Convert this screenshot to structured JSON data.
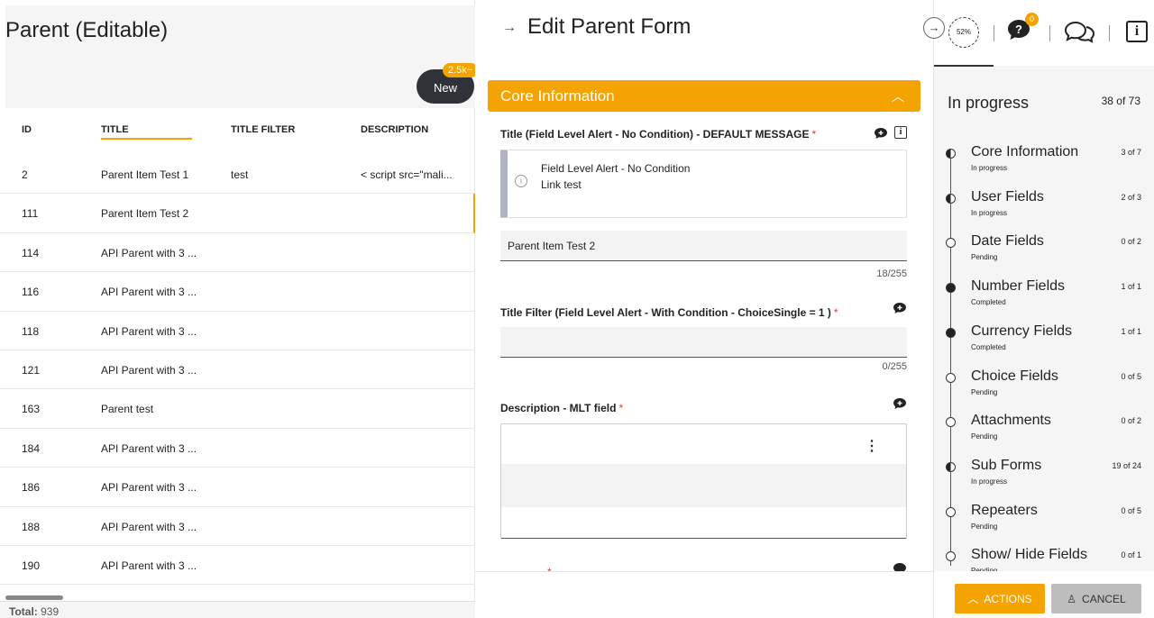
{
  "list": {
    "title": "Parent (Editable)",
    "new_button": "New",
    "new_badge": "2.5k~",
    "columns": [
      "ID",
      "TITLE",
      "TITLE FILTER",
      "DESCRIPTION"
    ],
    "rows": [
      {
        "id": "2",
        "title": "Parent Item Test 1",
        "title_filter": "test",
        "description": "< script  src=\"mali..."
      },
      {
        "id": "111",
        "title": "Parent Item Test 2",
        "title_filter": "",
        "description": ""
      },
      {
        "id": "114",
        "title": "API Parent with 3 ...",
        "title_filter": "",
        "description": ""
      },
      {
        "id": "116",
        "title": "API Parent with 3 ...",
        "title_filter": "",
        "description": ""
      },
      {
        "id": "118",
        "title": "API Parent with 3 ...",
        "title_filter": "",
        "description": ""
      },
      {
        "id": "121",
        "title": "API Parent with 3 ...",
        "title_filter": "",
        "description": ""
      },
      {
        "id": "163",
        "title": "Parent test",
        "title_filter": "",
        "description": ""
      },
      {
        "id": "184",
        "title": "API Parent with 3 ...",
        "title_filter": "",
        "description": ""
      },
      {
        "id": "186",
        "title": "API Parent with 3 ...",
        "title_filter": "",
        "description": ""
      },
      {
        "id": "188",
        "title": "API Parent with 3 ...",
        "title_filter": "",
        "description": ""
      },
      {
        "id": "190",
        "title": "API Parent with 3 ...",
        "title_filter": "",
        "description": ""
      }
    ],
    "total_label": "Total:",
    "total_value": "939"
  },
  "form": {
    "title": "Edit Parent Form",
    "section": "Core Information",
    "field1_label": "Title (Field Level Alert - No Condition) - DEFAULT MESSAGE",
    "alert_line1": "Field Level Alert - No Condition",
    "alert_line2": "Link test",
    "field1_value": "Parent Item Test 2",
    "field1_counter": "18/255",
    "field2_label": "Title Filter (Field Level Alert - With Condition - ChoiceSingle = 1 )",
    "field2_value": "",
    "field2_counter": "0/255",
    "field3_label": "Description - MLT field",
    "required_mark": "*"
  },
  "progress": {
    "percent": "52%",
    "questions_badge": "0",
    "title": "In progress",
    "count": "38 of 73",
    "steps": [
      {
        "name": "Core Information",
        "status": "In progress",
        "count": "3 of 7",
        "state": "half"
      },
      {
        "name": "User Fields",
        "status": "In progress",
        "count": "2 of 3",
        "state": "half"
      },
      {
        "name": "Date Fields",
        "status": "Pending",
        "count": "0 of 2",
        "state": "empty"
      },
      {
        "name": "Number Fields",
        "status": "Completed",
        "count": "1 of 1",
        "state": "full"
      },
      {
        "name": "Currency Fields",
        "status": "Completed",
        "count": "1 of 1",
        "state": "full"
      },
      {
        "name": "Choice Fields",
        "status": "Pending",
        "count": "0 of 5",
        "state": "empty"
      },
      {
        "name": "Attachments",
        "status": "Pending",
        "count": "0 of 2",
        "state": "empty"
      },
      {
        "name": "Sub Forms",
        "status": "In progress",
        "count": "19 of 24",
        "state": "half"
      },
      {
        "name": "Repeaters",
        "status": "Pending",
        "count": "0 of 5",
        "state": "empty"
      },
      {
        "name": "Show/ Hide Fields",
        "status": "Pending",
        "count": "0 of 1",
        "state": "empty"
      }
    ],
    "actions_label": "ACTIONS",
    "cancel_label": "CANCEL"
  },
  "colors": {
    "accent": "#f5a300",
    "dark": "#2f3238"
  }
}
